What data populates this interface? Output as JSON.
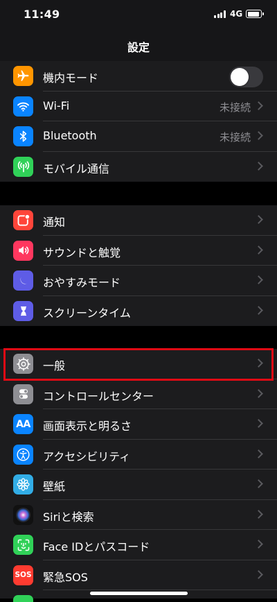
{
  "status_bar": {
    "time": "11:49",
    "network": "4G"
  },
  "nav": {
    "title": "設定"
  },
  "groups": [
    {
      "rows": [
        {
          "label": "機内モード",
          "icon": "airplane-icon",
          "color": "#ff9500",
          "toggle": false
        },
        {
          "label": "Wi-Fi",
          "icon": "wifi-icon",
          "color": "#0a84ff",
          "value": "未接続"
        },
        {
          "label": "Bluetooth",
          "icon": "bluetooth-icon",
          "color": "#0a84ff",
          "value": "未接続"
        },
        {
          "label": "モバイル通信",
          "icon": "cellular-icon",
          "color": "#30d158"
        }
      ]
    },
    {
      "rows": [
        {
          "label": "通知",
          "icon": "notifications-icon",
          "color": "#ff453a"
        },
        {
          "label": "サウンドと触覚",
          "icon": "sound-icon",
          "color": "#ff375f"
        },
        {
          "label": "おやすみモード",
          "icon": "moon-icon",
          "color": "#5e5ce6"
        },
        {
          "label": "スクリーンタイム",
          "icon": "hourglass-icon",
          "color": "#5e5ce6"
        }
      ]
    },
    {
      "rows": [
        {
          "label": "一般",
          "icon": "gear-icon",
          "color": "#8e8e93",
          "highlighted": true
        },
        {
          "label": "コントロールセンター",
          "icon": "toggle-switches-icon",
          "color": "#8e8e93"
        },
        {
          "label": "画面表示と明るさ",
          "icon": "text-size-icon",
          "color": "#0a84ff",
          "icon_text": "AA"
        },
        {
          "label": "アクセシビリティ",
          "icon": "accessibility-icon",
          "color": "#0a84ff"
        },
        {
          "label": "壁紙",
          "icon": "flower-icon",
          "color": "#32ade6"
        },
        {
          "label": "Siriと検索",
          "icon": "siri-icon",
          "color": "#000000"
        },
        {
          "label": "Face IDとパスコード",
          "icon": "face-id-icon",
          "color": "#30d158"
        },
        {
          "label": "緊急SOS",
          "icon": "sos-icon",
          "color": "#ff3b30",
          "icon_text": "SOS"
        }
      ]
    }
  ],
  "colors": {
    "highlight": "#e00a14",
    "accent": "#0a84ff",
    "secondary_text": "#8e8e93"
  }
}
